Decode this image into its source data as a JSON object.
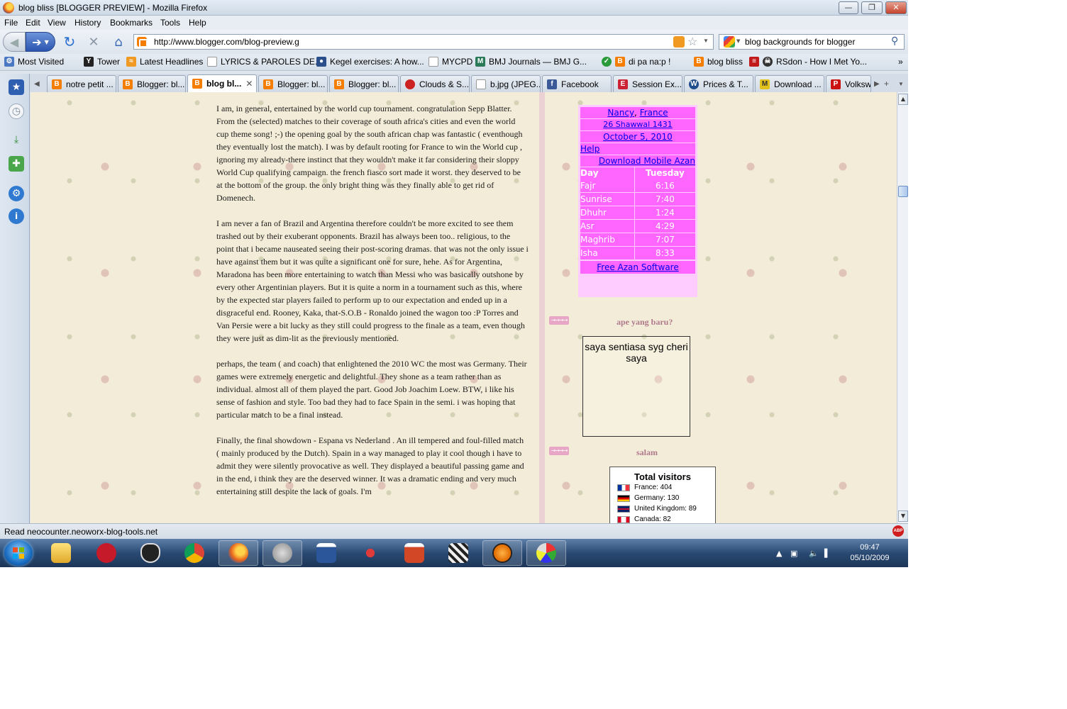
{
  "window": {
    "title": "blog bliss [BLOGGER PREVIEW] - Mozilla Firefox",
    "minimize": "—",
    "restore": "❐",
    "close": "✕"
  },
  "menu": [
    "File",
    "Edit",
    "View",
    "History",
    "Bookmarks",
    "Tools",
    "Help"
  ],
  "nav": {
    "url": "http://www.blogger.com/blog-preview.g",
    "search": "blog backgrounds for blogger"
  },
  "bookmarks": [
    {
      "label": "Most Visited",
      "icon": "gear-icon",
      "color": "#4a78c2"
    },
    {
      "label": "Tower",
      "icon": "yc-icon",
      "color": "#222222"
    },
    {
      "label": "Latest Headlines",
      "icon": "rss-icon",
      "color": "#f09a24"
    },
    {
      "label": "LYRICS & PAROLES DE...",
      "icon": "page-icon",
      "color": "#ffffff"
    },
    {
      "label": "Kegel exercises: A how...",
      "icon": "mayo-icon",
      "color": "#2a4f8a"
    },
    {
      "label": "MYCPD",
      "icon": "page-icon",
      "color": "#ffffff"
    },
    {
      "label": "BMJ Journals — BMJ G...",
      "icon": "m-icon",
      "color": "#2a7a5a"
    },
    {
      "label": "di pa na:p !",
      "icon": "blogger-icon",
      "color": "#f57d00"
    },
    {
      "label": "blog bliss",
      "icon": "blogger-icon",
      "color": "#f57d00"
    },
    {
      "label": "RSdon - How I Met Yo...",
      "icon": "skull-icon",
      "color": "#333333"
    }
  ],
  "tabs": [
    {
      "label": "notre petit ...",
      "color": "#f57d00"
    },
    {
      "label": "Blogger: bl...",
      "color": "#f57d00"
    },
    {
      "label": "blog bl...",
      "color": "#f57d00",
      "active": true
    },
    {
      "label": "Blogger: bl...",
      "color": "#f57d00"
    },
    {
      "label": "Blogger: bl...",
      "color": "#f57d00"
    },
    {
      "label": "Clouds & S...",
      "color": "#cc2222"
    },
    {
      "label": "b.jpg (JPEG...",
      "color": "#ffffff"
    },
    {
      "label": "Facebook",
      "color": "#3b5998"
    },
    {
      "label": "Session Ex...",
      "color": "#cc2233"
    },
    {
      "label": "Prices & T...",
      "color": "#1f4e8c"
    },
    {
      "label": "Download ...",
      "color": "#e2c21a"
    },
    {
      "label": "Volksw...",
      "color": "#cc1111"
    }
  ],
  "post": {
    "paragraphs": [
      "I am, in general, entertained by the world cup tournament. congratulation Sepp Blatter. From the (selected) matches to their coverage of south africa's cities and even the world cup theme song! ;-) the opening goal by the south african chap was fantastic ( eventhough they eventually lost the match). I was by default rooting for France to win the World cup , ignoring my already-there instinct that they wouldn't make it far considering their sloppy World Cup qualifying campaign. the french fiasco sort made it worst. they deserved to be at the bottom of the group. the only bright thing was they finally able to get rid of Domenech.",
      "I am never a fan of Brazil and Argentina therefore couldn't be more excited to see them trashed out by their exuberant opponents. Brazil has always been too.. religious, to the point that i became nauseated seeing their post-scoring dramas. that was not the only issue i have against them but it was quite a significant one for sure, hehe. As for Argentina, Maradona has been more entertaining to watch than Messi who was basically outshone by every other Argentinian players. But it is quite a norm in a tournament such as this, where by the expected star players failed to perform up to our expectation and ended up in a disgraceful end. Rooney, Kaka, that-S.O.B - Ronaldo joined the wagon too :P Torres and Van Persie were a bit lucky as they still could progress to the finale as a team, even though they were just as dim-lit as the previously mentioned.",
      "perhaps, the team ( and coach) that enlightened the 2010 WC the most was Germany. Their games were extremely energetic and delightful. They shone as a team rather than as individual. almost all of them played the part. Good Job Joachim Loew. BTW, i like his sense of fashion and style. Too bad they had to face Spain in the semi. i was hoping that particular match to be a final instead.",
      "Finally, the final showdown - Espana vs Nederland . An ill tempered and foul-filled match ( mainly produced by the Dutch). Spain in a way managed to play it cool though i have to admit they were silently provocative as well. They displayed a beautiful passing game and in the end, i think they are the deserved winner. It was a dramatic ending and very much entertaining still despite the lack of goals. I'm"
    ]
  },
  "prayer": {
    "city": "Nancy",
    "sep": ", ",
    "country": "France",
    "hijri": "26 Shawwal 1431",
    "date": "October 5, 2010",
    "help": "Help",
    "download": "Download Mobile Azan",
    "col_day": "Day",
    "col_today": "Tuesday",
    "times": [
      {
        "name": "Fajr",
        "time": "6:16"
      },
      {
        "name": "Sunrise",
        "time": "7:40"
      },
      {
        "name": "Dhuhr",
        "time": "1:24"
      },
      {
        "name": "Asr",
        "time": "4:29"
      },
      {
        "name": "Maghrib",
        "time": "7:07"
      },
      {
        "name": "Isha",
        "time": "8:33"
      }
    ],
    "footer": "Free Azan Software"
  },
  "sidebar_sections": {
    "new_title": "ape yang baru?",
    "note": "saya sentiasa syg cheri saya",
    "salam_title": "salam",
    "arrow": "→→→→"
  },
  "visitors": {
    "title": "Total visitors",
    "rows": [
      {
        "label": "France: 404",
        "flag": "france-flag"
      },
      {
        "label": "Germany: 130",
        "flag": "germany-flag"
      },
      {
        "label": "United Kingdom: 89",
        "flag": "uk-flag"
      },
      {
        "label": "Canada: 82",
        "flag": "canada-flag"
      }
    ]
  },
  "status": {
    "text": "Read neocounter.neoworx-blog-tools.net",
    "abp": "ABP"
  },
  "clock": {
    "time": "09:47",
    "date": "05/10/2009"
  },
  "colors": {
    "widget_pink": "#ff66ff",
    "widget_light": "#ffccff",
    "link_blue": "#0000ee",
    "section_title": "#b07a8c"
  }
}
